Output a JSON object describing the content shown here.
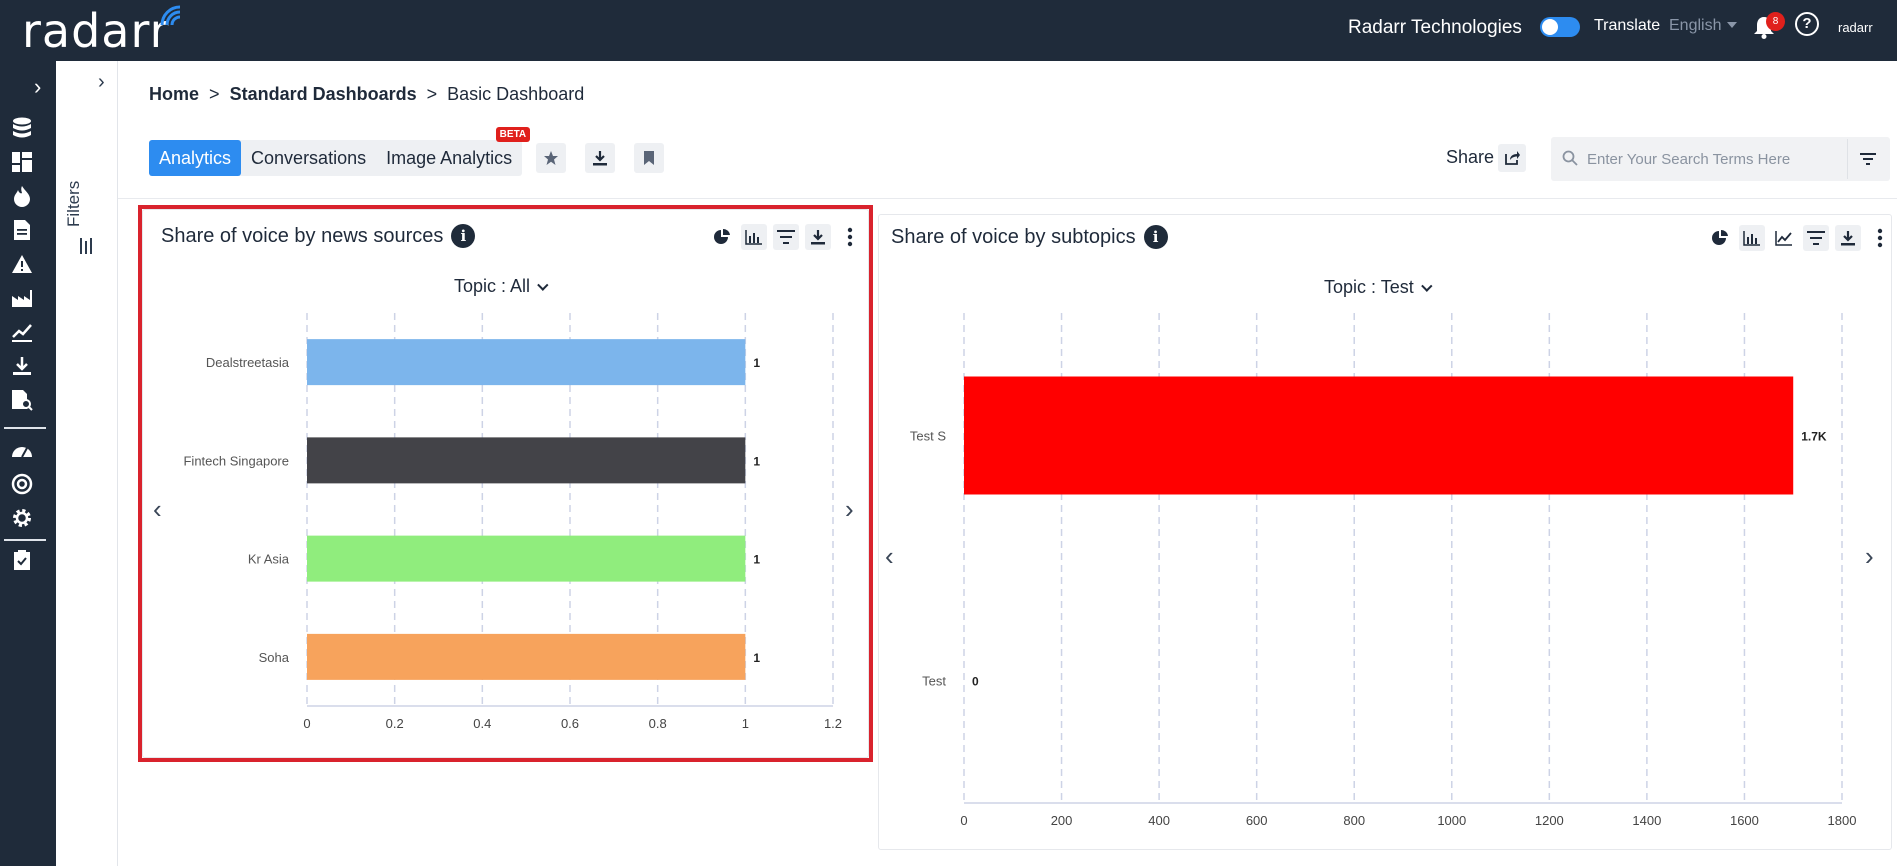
{
  "header": {
    "logo": "radarr",
    "company": "Radarr Technologies",
    "translate_label": "Translate",
    "language": "English",
    "notification_count": "8",
    "mini_logo": "radarr"
  },
  "filters": {
    "label": "Filters"
  },
  "breadcrumb": {
    "home": "Home",
    "sep1": ">",
    "dashboards": "Standard Dashboards",
    "sep2": ">",
    "current": "Basic Dashboard"
  },
  "tabs": [
    {
      "label": "Analytics",
      "active": true
    },
    {
      "label": "Conversations",
      "active": false
    },
    {
      "label": "Image Analytics",
      "active": false,
      "badge": "BETA"
    }
  ],
  "share": {
    "label": "Share"
  },
  "search": {
    "placeholder": "Enter Your Search Terms Here"
  },
  "cards": [
    {
      "title": "Share of voice by news sources",
      "topic_label": "Topic : All",
      "highlighted": true,
      "chart_data": {
        "type": "bar",
        "orientation": "horizontal",
        "categories": [
          "Dealstreetasia",
          "Fintech Singapore",
          "Kr Asia",
          "Soha"
        ],
        "values": [
          1,
          1,
          1,
          1
        ],
        "data_labels": [
          "1",
          "1",
          "1",
          "1"
        ],
        "colors": [
          "#7cb5ec",
          "#434348",
          "#90ed7d",
          "#f7a35c"
        ],
        "xlim": [
          0,
          1.2
        ],
        "xticks": [
          "0",
          "0.2",
          "0.4",
          "0.6",
          "0.8",
          "1",
          "1.2"
        ],
        "grid": true
      }
    },
    {
      "title": "Share of voice by subtopics",
      "topic_label": "Topic : Test",
      "highlighted": false,
      "chart_data": {
        "type": "bar",
        "orientation": "horizontal",
        "categories": [
          "Test S",
          "Test"
        ],
        "values": [
          1700,
          0
        ],
        "data_labels": [
          "1.7K",
          "0"
        ],
        "colors": [
          "#ff0000",
          "#ff0000"
        ],
        "xlim": [
          0,
          1800
        ],
        "xticks": [
          "0",
          "200",
          "400",
          "600",
          "800",
          "1000",
          "1200",
          "1400",
          "1600",
          "1800"
        ],
        "grid": true
      }
    }
  ],
  "colors": {
    "topbar": "#1f2b3a",
    "accent": "#2d8cf0",
    "highlight": "#d9232d",
    "badge": "#e0201c"
  }
}
